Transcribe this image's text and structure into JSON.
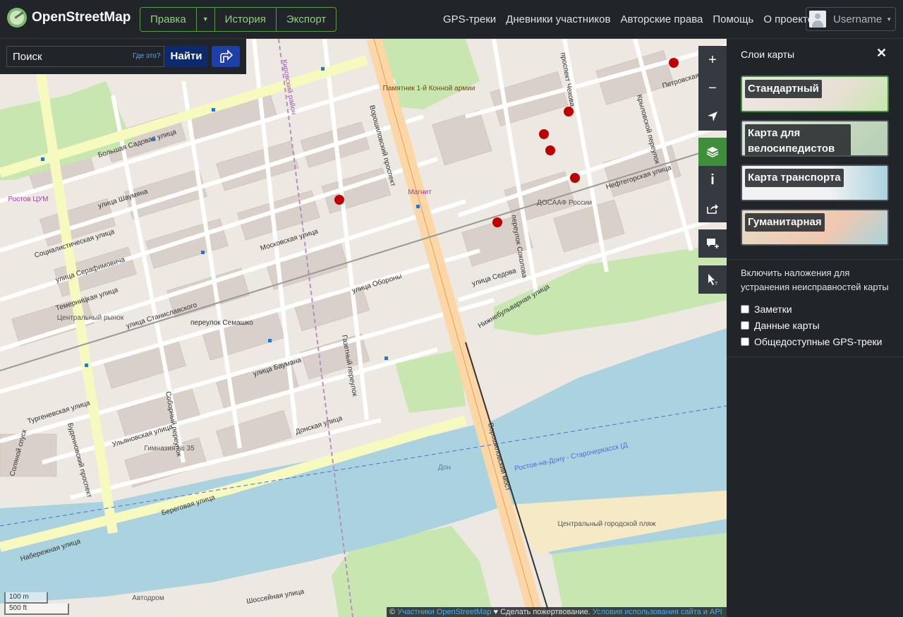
{
  "header": {
    "logo_text": "OpenStreetMap",
    "edit_label": "Правка",
    "history_label": "История",
    "export_label": "Экспорт",
    "nav": [
      "GPS-треки",
      "Дневники участников",
      "Авторские права",
      "Помощь",
      "О проекте"
    ],
    "username": "Username"
  },
  "search": {
    "placeholder": "Поиск",
    "where_link": "Где это?",
    "find_label": "Найти",
    "directions_icon": "directions-icon"
  },
  "map_controls": [
    "zoom-in-icon",
    "zoom-out-icon",
    "locate-icon",
    "layers-icon",
    "info-icon",
    "share-icon",
    "note-icon",
    "query-icon"
  ],
  "map_labels": {
    "streets": [
      "Большая Садовая улица",
      "улица Шаумяна",
      "Социалистическая улица",
      "улица Серафимовича",
      "Темерницкая улица",
      "Московская улица",
      "улица Станиславского",
      "улица Обороны",
      "Тургеневская улица",
      "улица Баумана",
      "Ульяновская улица",
      "Донская улица",
      "Береговая улица",
      "Набережная улица",
      "Ворошиловский проспект",
      "Буденновский проспект",
      "переулок Семашко",
      "Газетный переулок",
      "Соборный переулок",
      "Кировский район",
      "проспект Чехова",
      "Крыловской переулок",
      "Нефтегорская улица",
      "Петровская улица",
      "Нижнебульварная улица",
      "переулок Соколова",
      "улица Седова",
      "Шоссейная улица",
      "Соляной спуск",
      "Ворошиловский мост"
    ],
    "places": [
      "Памятник 1-й Конной армии",
      "Ростов ЦУМ",
      "Центральный рынок",
      "Магнит",
      "ДОСААФ России",
      "Гимназия № 35",
      "Центральный городской пляж",
      "Автодром",
      "Дон",
      "Ростов-на-Дону - Старочеркасск (Д"
    ]
  },
  "scale": {
    "metric": "100 m",
    "imperial": "500 ft"
  },
  "attribution": {
    "prefix": "©",
    "osm": "Участники OpenStreetMap",
    "heart": "♥",
    "donate": "Сделать пожертвование.",
    "terms": "Условия использования сайта и API"
  },
  "layers_panel": {
    "title": "Слои карты",
    "close_icon": "✕",
    "layers": [
      {
        "label": "Стандартный",
        "selected": true
      },
      {
        "label": "Карта для велосипедистов",
        "selected": false
      },
      {
        "label": "Карта транспорта",
        "selected": false
      },
      {
        "label": "Гуманитарная",
        "selected": false
      }
    ],
    "overlay_heading": "Включить наложения для устранения неисправностей карты",
    "overlays": [
      {
        "label": "Заметки",
        "checked": false
      },
      {
        "label": "Данные карты",
        "checked": false
      },
      {
        "label": "Общедоступные GPS-треки",
        "checked": false
      }
    ]
  },
  "colors": {
    "background": "#212529",
    "accent": "#7ebc6f",
    "water": "#aad3df",
    "park": "#c8e6b0",
    "major_road": "#fcd6a4",
    "land": "#ede8e1"
  }
}
